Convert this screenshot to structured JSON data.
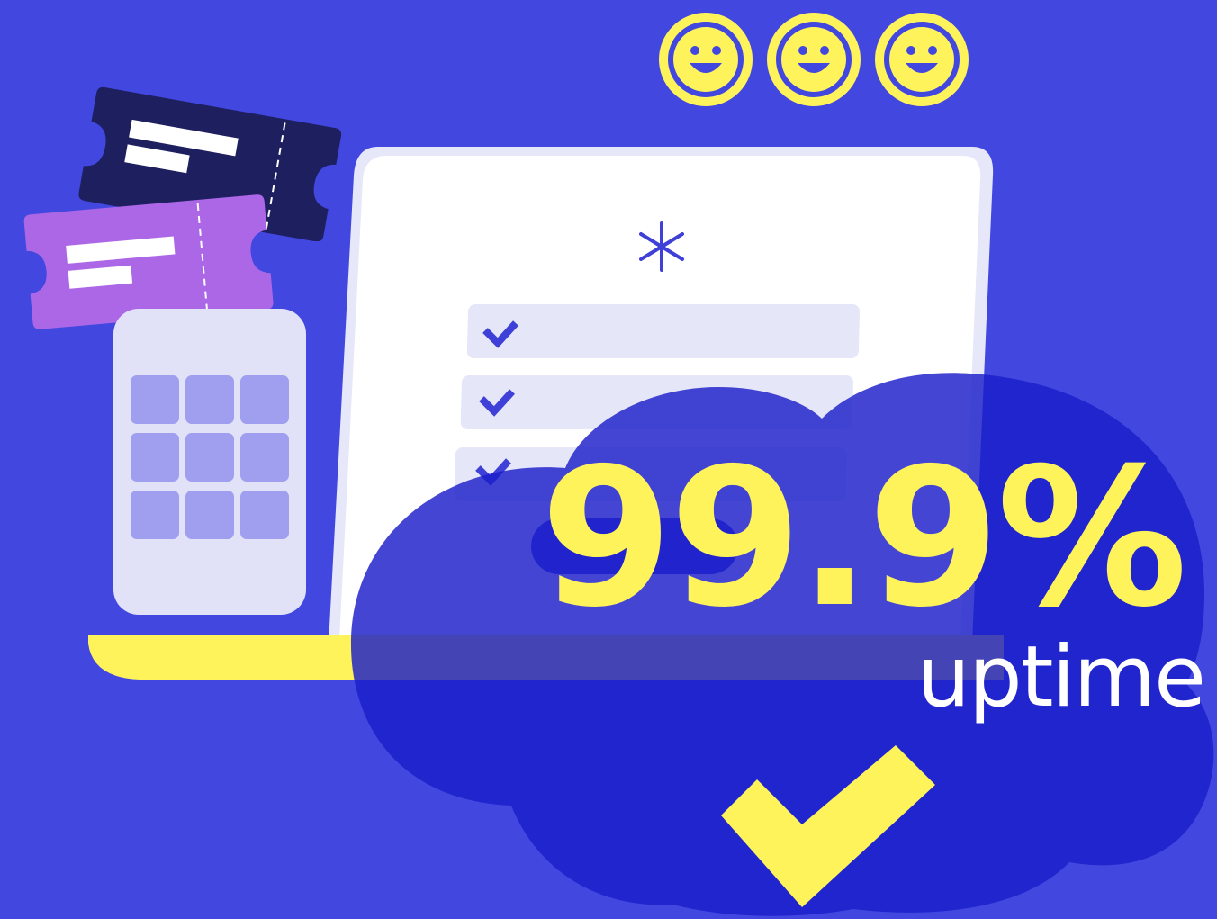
{
  "headline": {
    "value": "99.9%",
    "caption": "uptime"
  },
  "icons": {
    "smileys": [
      "smiley-face-icon",
      "smiley-face-icon",
      "smiley-face-icon"
    ],
    "tickets": [
      "ticket-icon",
      "ticket-icon"
    ],
    "keypad": "keypad-icon",
    "logo": "asterisk-logo-icon",
    "form_checks": [
      "check-icon",
      "check-icon",
      "check-icon"
    ],
    "cloud": "cloud-icon",
    "big_check": "big-checkmark-icon"
  },
  "colors": {
    "background": "#4147DF",
    "accent_yellow": "#FFF35C",
    "cloud_blue": "#1B1DC9",
    "ticket_dark": "#1E1F5E",
    "ticket_purple": "#AB67E6",
    "laptop_screen": "#FFFFFF",
    "laptop_frame": "#E6E7F9"
  }
}
